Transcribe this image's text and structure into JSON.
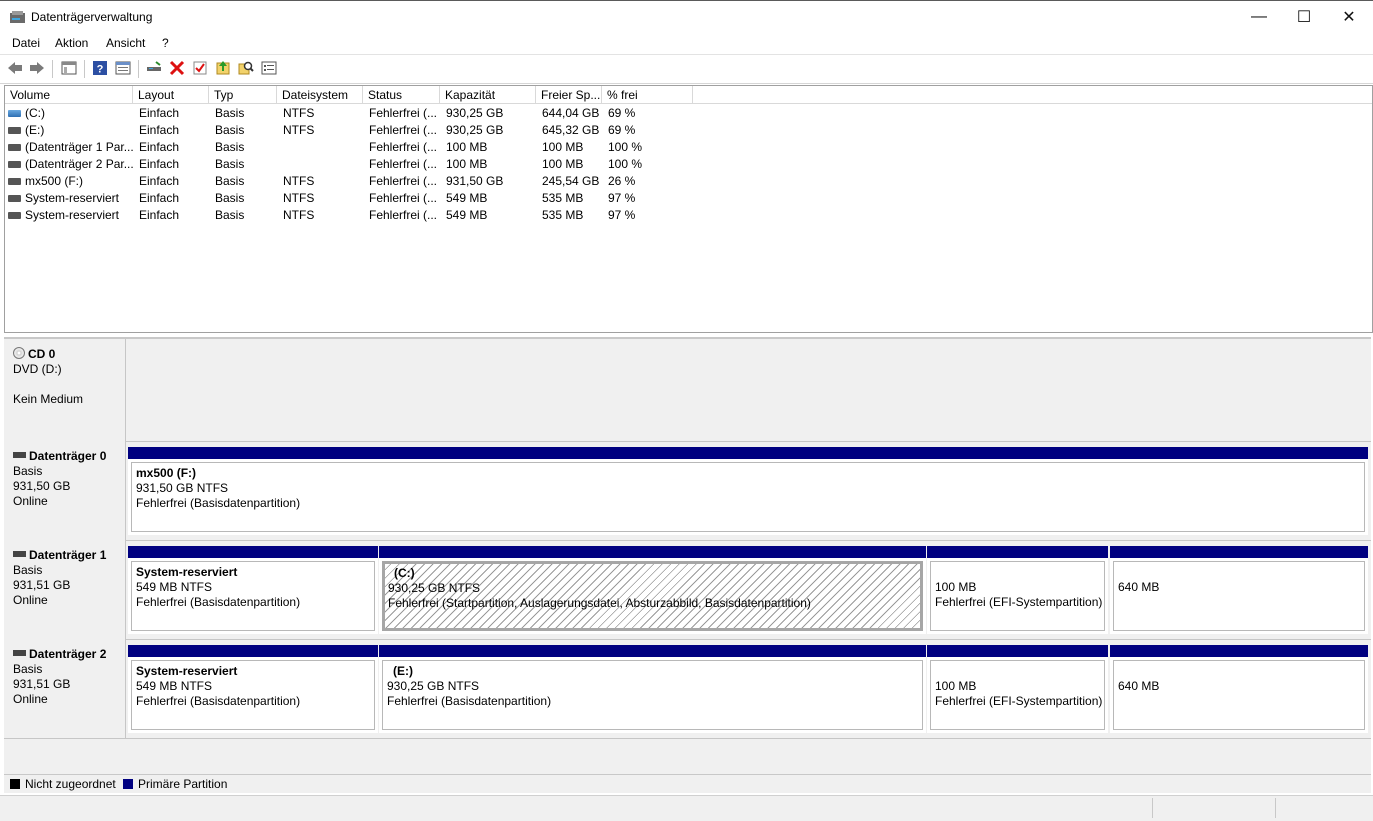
{
  "window": {
    "title": "Datenträgerverwaltung",
    "minimize": "—",
    "maximize": "☐",
    "close": "✕"
  },
  "menu": [
    "Datei",
    "Aktion",
    "Ansicht",
    "?"
  ],
  "toolbar_icons": [
    "back-icon",
    "forward-icon",
    "console-tree-icon",
    "help-icon",
    "properties-icon",
    "connect-icon",
    "delete-icon",
    "checkmark-icon",
    "upload-icon",
    "search-icon",
    "settings-list-icon"
  ],
  "volume_list": {
    "headers": [
      "Volume",
      "Layout",
      "Typ",
      "Dateisystem",
      "Status",
      "Kapazität",
      "Freier Sp...",
      "% frei"
    ],
    "rows": [
      [
        "(C:)",
        "Einfach",
        "Basis",
        "NTFS",
        "Fehlerfrei (...",
        "930,25 GB",
        "644,04 GB",
        "69 %"
      ],
      [
        "(E:)",
        "Einfach",
        "Basis",
        "NTFS",
        "Fehlerfrei (...",
        "930,25 GB",
        "645,32 GB",
        "69 %"
      ],
      [
        "(Datenträger 1 Par...",
        "Einfach",
        "Basis",
        "",
        "Fehlerfrei (...",
        "100 MB",
        "100 MB",
        "100 %"
      ],
      [
        "(Datenträger 2 Par...",
        "Einfach",
        "Basis",
        "",
        "Fehlerfrei (...",
        "100 MB",
        "100 MB",
        "100 %"
      ],
      [
        "mx500 (F:)",
        "Einfach",
        "Basis",
        "NTFS",
        "Fehlerfrei (...",
        "931,50 GB",
        "245,54 GB",
        "26 %"
      ],
      [
        "System-reserviert",
        "Einfach",
        "Basis",
        "NTFS",
        "Fehlerfrei (...",
        "549 MB",
        "535 MB",
        "97 %"
      ],
      [
        "System-reserviert",
        "Einfach",
        "Basis",
        "NTFS",
        "Fehlerfrei (...",
        "549 MB",
        "535 MB",
        "97 %"
      ]
    ]
  },
  "disks": {
    "cd0": {
      "name": "CD 0",
      "line1": "DVD (D:)",
      "line2": "Kein Medium"
    },
    "d0": {
      "name": "Datenträger 0",
      "type": "Basis",
      "size": "931,50 GB",
      "status": "Online",
      "p1": {
        "name": "mx500  (F:)",
        "size": "931,50 GB NTFS",
        "status": "Fehlerfrei (Basisdatenpartition)"
      }
    },
    "d1": {
      "name": "Datenträger 1",
      "type": "Basis",
      "size": "931,51 GB",
      "status": "Online",
      "p1": {
        "name": "System-reserviert",
        "size": "549 MB NTFS",
        "status": "Fehlerfrei (Basisdatenpartition)"
      },
      "p2": {
        "name": "(C:)",
        "size": "930,25 GB NTFS",
        "status": "Fehlerfrei (Startpartition, Auslagerungsdatei, Absturzabbild, Basisdatenpartition)"
      },
      "p3": {
        "size": "100 MB",
        "status": "Fehlerfrei (EFI-Systempartition)"
      },
      "p4": {
        "size": "640 MB"
      }
    },
    "d2": {
      "name": "Datenträger 2",
      "type": "Basis",
      "size": "931,51 GB",
      "status": "Online",
      "p1": {
        "name": "System-reserviert",
        "size": "549 MB NTFS",
        "status": "Fehlerfrei (Basisdatenpartition)"
      },
      "p2": {
        "name": "(E:)",
        "size": "930,25 GB NTFS",
        "status": "Fehlerfrei (Basisdatenpartition)"
      },
      "p3": {
        "size": "100 MB",
        "status": "Fehlerfrei (EFI-Systempartition)"
      },
      "p4": {
        "size": "640 MB"
      }
    }
  },
  "legend": {
    "unallocated": "Nicht zugeordnet",
    "primary": "Primäre Partition",
    "unallocated_color": "#000000",
    "primary_color": "#000080"
  }
}
